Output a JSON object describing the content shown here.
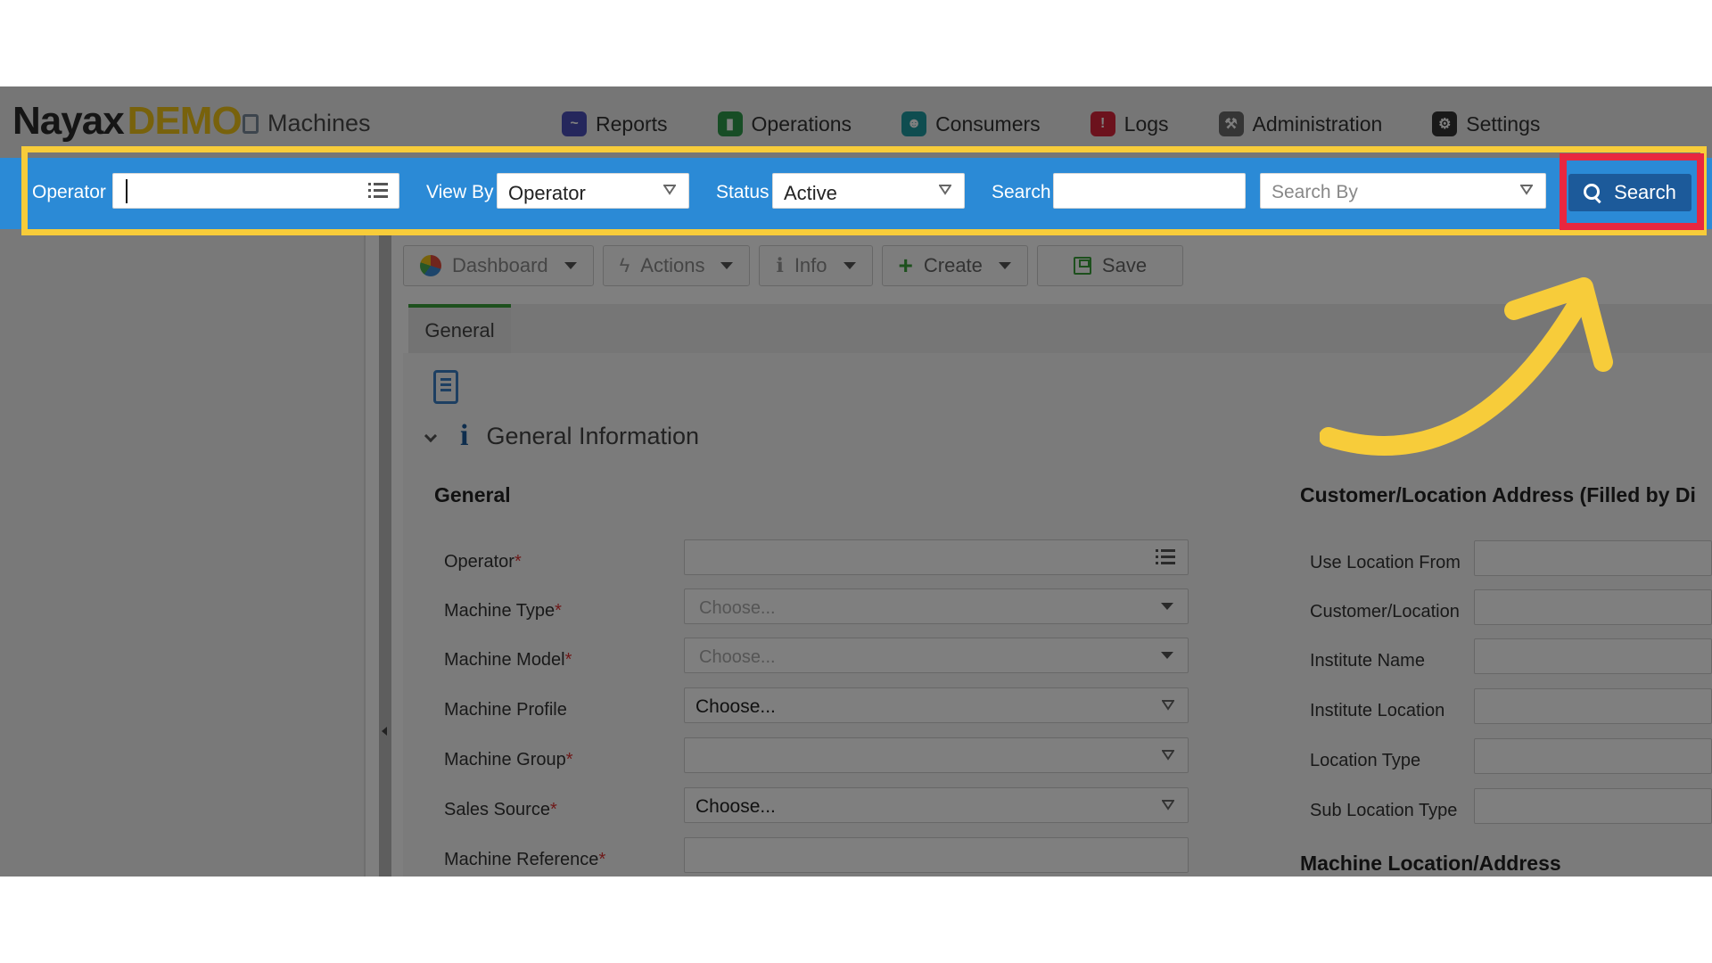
{
  "header": {
    "logo_primary": "Nayax",
    "logo_secondary": "DEMO",
    "page_title": "Machines",
    "nav": [
      {
        "label": "Reports",
        "icon": "reports-icon",
        "color": "#4a4fb8"
      },
      {
        "label": "Operations",
        "icon": "operations-icon",
        "color": "#2e9a4a"
      },
      {
        "label": "Consumers",
        "icon": "consumers-icon",
        "color": "#1f9aa0"
      },
      {
        "label": "Logs",
        "icon": "logs-icon",
        "color": "#d8243a"
      },
      {
        "label": "Administration",
        "icon": "administration-icon",
        "color": "#6a6a6a"
      },
      {
        "label": "Settings",
        "icon": "gear-icon",
        "color": "#333333"
      }
    ]
  },
  "filterbar": {
    "operator_label": "Operator",
    "operator_value": "",
    "viewby_label": "View By",
    "viewby_value": "Operator",
    "status_label": "Status",
    "status_value": "Active",
    "search_label": "Search",
    "search_value": "",
    "searchby_placeholder": "Search By",
    "search_button": "Search",
    "bar_color": "#2b8ad6",
    "button_color": "#1c5a9a"
  },
  "toolbar": {
    "dashboard": "Dashboard",
    "actions": "Actions",
    "info": "Info",
    "create": "Create",
    "save": "Save"
  },
  "tabs": [
    {
      "label": "General",
      "active": true
    }
  ],
  "section": {
    "title": "General Information"
  },
  "form": {
    "left_heading": "General",
    "right_heading": "Customer/Location Address (Filled by Di",
    "right_heading2": "Machine Location/Address",
    "left_fields": [
      {
        "label": "Operator",
        "required": "*",
        "value": "",
        "placeholder": "",
        "kind": "list"
      },
      {
        "label": "Machine Type",
        "required": "*",
        "value": "",
        "placeholder": "Choose...",
        "kind": "dropdown"
      },
      {
        "label": "Machine Model",
        "required": "*",
        "value": "",
        "placeholder": "Choose...",
        "kind": "dropdown"
      },
      {
        "label": "Machine Profile",
        "required": "",
        "value": "Choose...",
        "placeholder": "",
        "kind": "select"
      },
      {
        "label": "Machine Group",
        "required": "*",
        "value": "",
        "placeholder": "",
        "kind": "select"
      },
      {
        "label": "Sales Source",
        "required": "*",
        "value": "Choose...",
        "placeholder": "",
        "kind": "select"
      },
      {
        "label": "Machine Reference",
        "required": "*",
        "value": "",
        "placeholder": "",
        "kind": "text"
      }
    ],
    "right_fields": [
      {
        "label": "Use Location From"
      },
      {
        "label": "Customer/Location"
      },
      {
        "label": "Institute Name"
      },
      {
        "label": "Institute Location"
      },
      {
        "label": "Location Type"
      },
      {
        "label": "Sub Location Type"
      }
    ]
  },
  "annotation": {
    "highlight_color": "#f7cc3a",
    "focus_color": "#e8273f"
  }
}
